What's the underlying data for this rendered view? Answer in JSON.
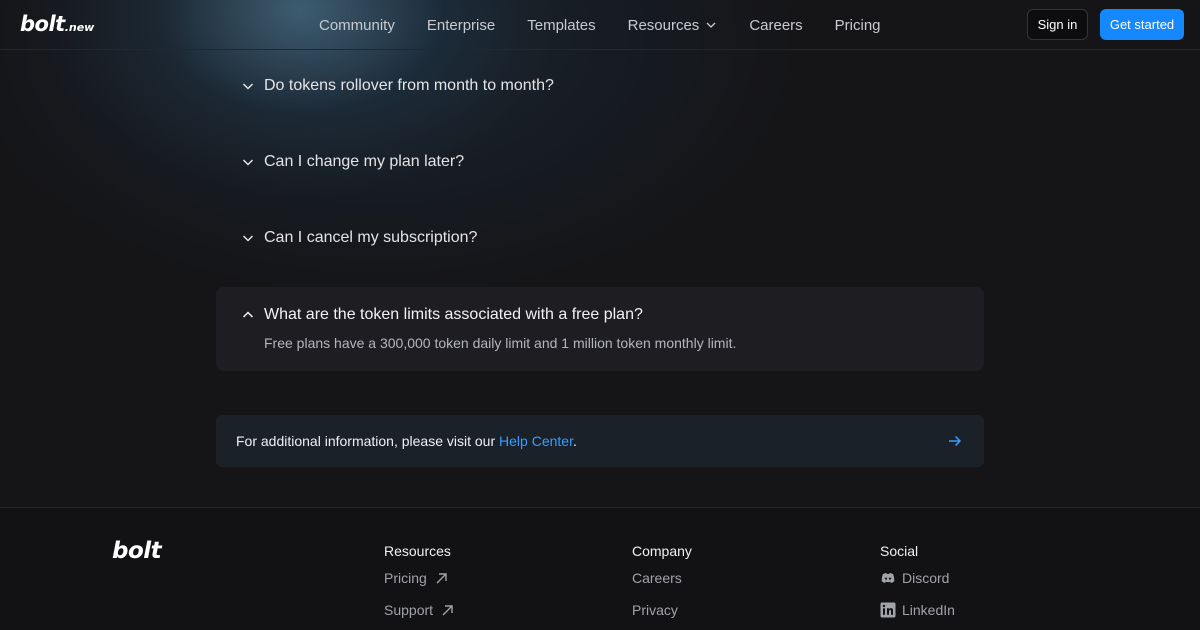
{
  "header": {
    "logo_text": "bolt",
    "logo_suffix": ".new",
    "nav": [
      "Community",
      "Enterprise",
      "Templates",
      "Resources",
      "Careers",
      "Pricing"
    ],
    "sign_in": "Sign in",
    "get_started": "Get started"
  },
  "faq": {
    "items": [
      "Do tokens rollover from month to month?",
      "Can I change my plan later?",
      "Can I cancel my subscription?"
    ],
    "open_question": "What are the token limits associated with a free plan?",
    "open_answer": "Free plans have a 300,000 token daily limit and 1 million token monthly limit."
  },
  "info": {
    "prefix": "For additional information, please visit our ",
    "link": "Help Center",
    "suffix": "."
  },
  "footer": {
    "logo_text": "bolt",
    "resources": {
      "title": "Resources",
      "links": [
        "Pricing",
        "Support"
      ]
    },
    "company": {
      "title": "Company",
      "links": [
        "Careers",
        "Privacy"
      ]
    },
    "social": {
      "title": "Social",
      "links": [
        "Discord",
        "LinkedIn"
      ]
    }
  },
  "colors": {
    "accent": "#1488fc",
    "link": "#3b9cff",
    "background": "#151518"
  },
  "icons": [
    "chevron-down-icon",
    "chevron-up-icon",
    "arrow-right-icon",
    "external-link-icon",
    "discord-icon",
    "linkedin-icon"
  ]
}
